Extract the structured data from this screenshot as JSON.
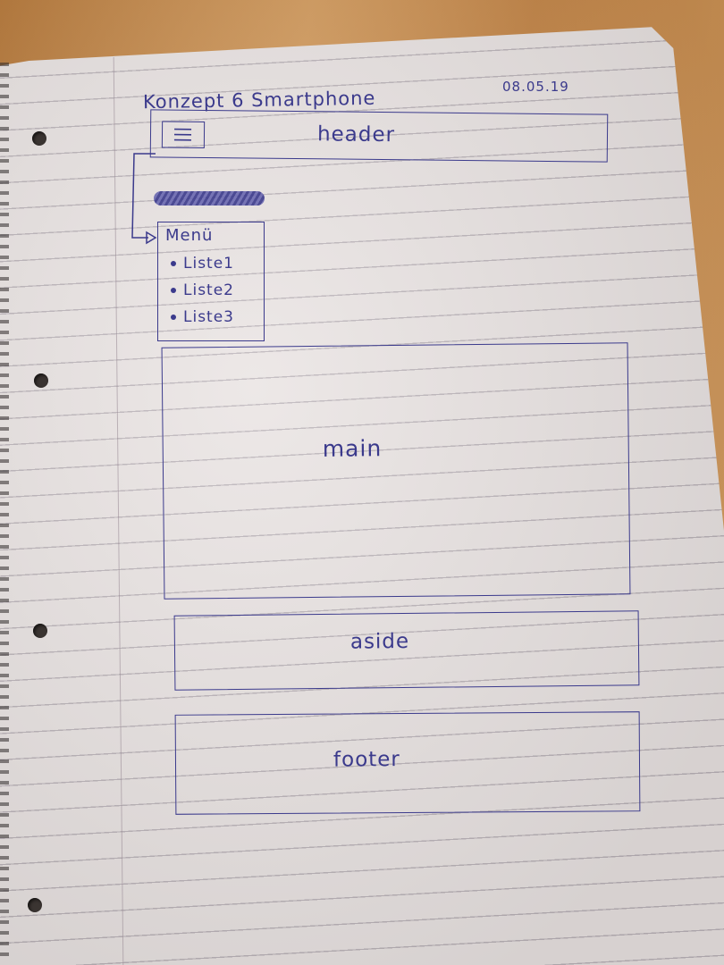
{
  "sketch": {
    "title": "Konzept 6 Smartphone",
    "date": "08.05.19",
    "header_label": "header",
    "hamburger_icon": "hamburger-menu-icon",
    "menu": {
      "title": "Menü",
      "items": [
        "Liste1",
        "Liste2",
        "Liste3"
      ]
    },
    "main_label": "main",
    "aside_label": "aside",
    "footer_label": "footer"
  },
  "colors": {
    "ink": "#3b3a8c",
    "paper": "#e9e3e2",
    "desk": "#c98c4e"
  }
}
